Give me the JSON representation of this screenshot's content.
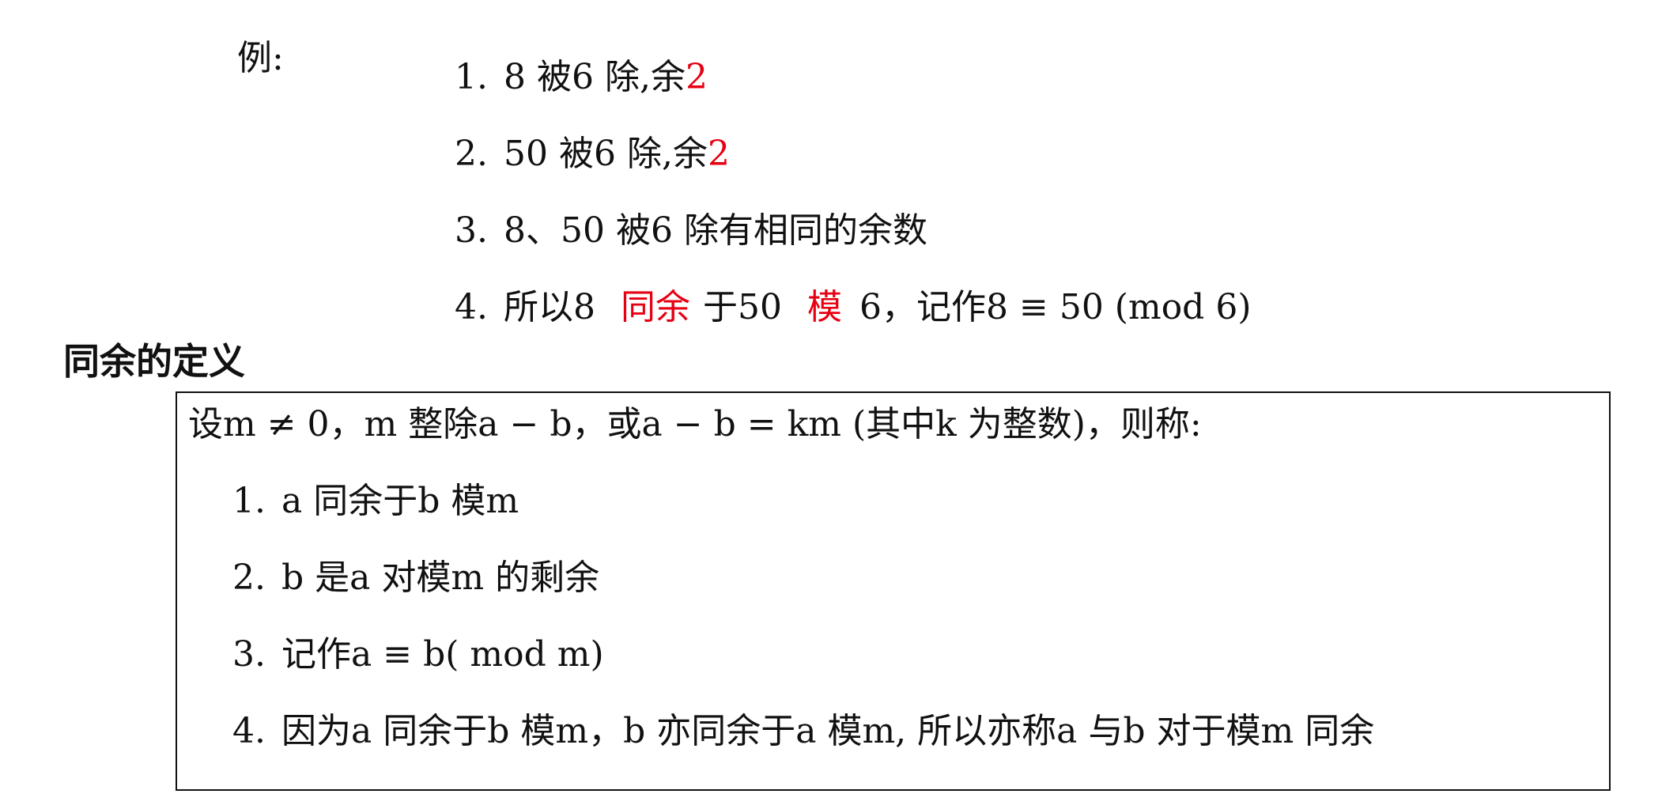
{
  "example": {
    "label": "例:",
    "items": [
      {
        "num": "1.",
        "pre": "8 被6 除,余",
        "rem": "2"
      },
      {
        "num": "2.",
        "pre": "50 被6 除,余",
        "rem": "2"
      },
      {
        "num": "3.",
        "text": "8、50 被6 除有相同的余数"
      },
      {
        "num": "4.",
        "a": "所以8",
        "b": "同余",
        "c": "于50",
        "d": "模",
        "e": "6，记作8 ≡ 50 (mod 6)"
      }
    ]
  },
  "definition": {
    "heading": "同余的定义",
    "intro": "设m ≠ 0，m 整除a − b，或a − b = km (其中k 为整数)，则称:",
    "items": [
      {
        "num": "1.",
        "text": "a 同余于b 模m"
      },
      {
        "num": "2.",
        "text": "b 是a 对模m 的剩余"
      },
      {
        "num": "3.",
        "text": "记作a ≡ b( mod m)"
      },
      {
        "num": "4.",
        "text": "因为a 同余于b 模m，b 亦同余于a 模m, 所以亦称a 与b 对于模m 同余"
      }
    ]
  },
  "colors": {
    "accent": "#e60012",
    "text": "#111111",
    "border": "#111111"
  }
}
